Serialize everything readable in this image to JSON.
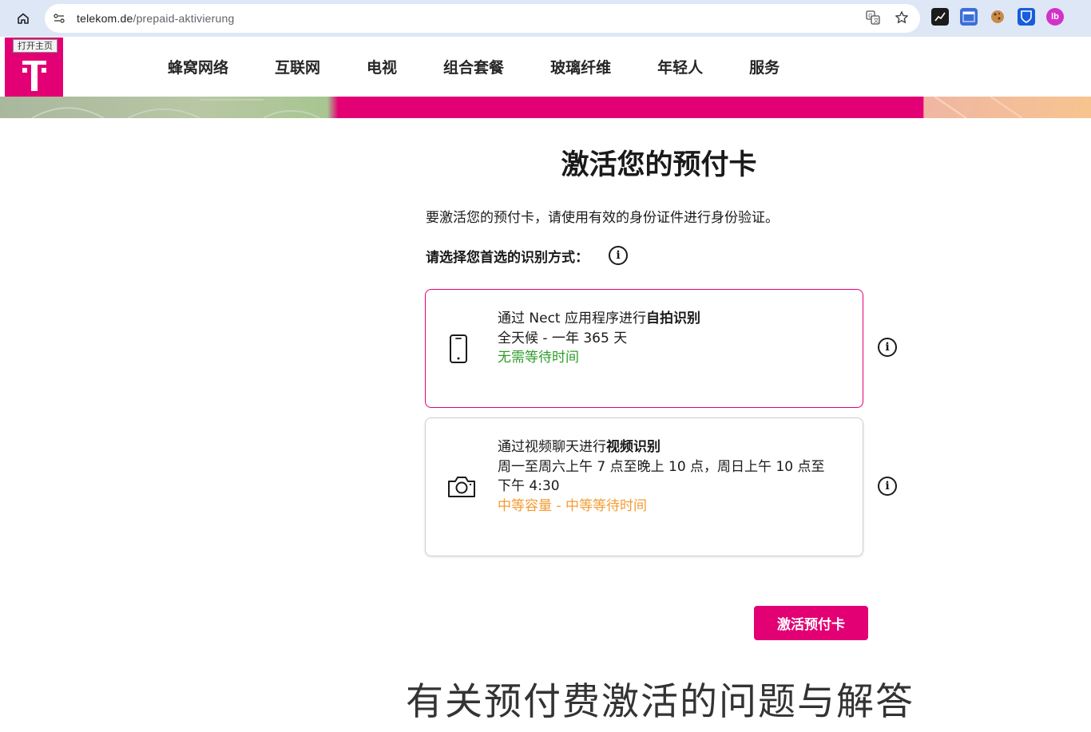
{
  "browser": {
    "url_domain": "telekom.de",
    "url_path": "/prepaid-aktivierung",
    "icons": [
      "home-icon",
      "site-info-icon",
      "translate-icon",
      "bookmark-star-icon"
    ],
    "extensions": [
      "ext-chart",
      "ext-window",
      "ext-cookie",
      "ext-bitwarden",
      "ext-lb"
    ]
  },
  "header": {
    "logo_tooltip": "打开主页",
    "nav": [
      "蜂窝网络",
      "互联网",
      "电视",
      "组合套餐",
      "玻璃纤维",
      "年轻人",
      "服务"
    ]
  },
  "main": {
    "title": "激活您的预付卡",
    "intro": "要激活您的预付卡，请使用有效的身份证件进行身份验证。",
    "choose_label": "请选择您首选的识别方式：",
    "options": [
      {
        "line1_prefix": "通过 Nect 应用程序进行",
        "line1_bold": "自拍识别",
        "line2": "全天候 - 一年 365 天",
        "status": "无需等待时间",
        "icon": "smartphone-icon"
      },
      {
        "line1_prefix": "通过视频聊天进行",
        "line1_bold": "视频识别",
        "line2": "周一至周六上午 7 点至晚上 10 点，周日上午 10 点至下午 4:30",
        "status": "中等容量 - 中等等待时间",
        "icon": "camera-icon"
      }
    ],
    "cta_label": "激活预付卡",
    "faq_title": "有关预付费激活的问题与解答"
  },
  "colors": {
    "brand": "#e20074",
    "green_status": "#2e9c2a",
    "orange_status": "#f39c33"
  }
}
